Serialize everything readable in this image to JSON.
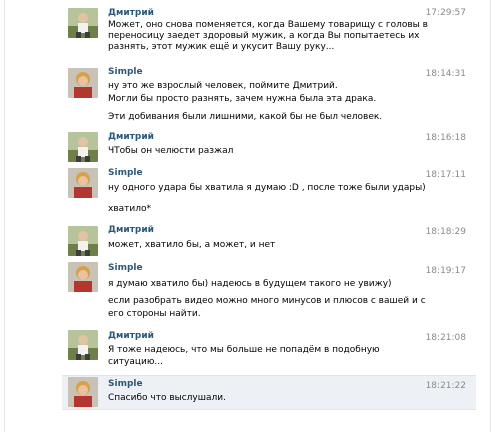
{
  "messages": [
    {
      "sender": "Дмитрий",
      "time": "17:29:57",
      "lines": [
        "Может, оно снова поменяется, когда Вашему товарищу с головы в",
        "переносицу заедет здоровый мужик, а когда Вы попытаетесь их",
        "разнять, этот мужик ещё и укусит Вашу руку..."
      ]
    },
    {
      "sender": "Simple",
      "time": "18:14:31",
      "lines": [
        "ну это же взрослый человек, поймите Дмитрий.",
        "Могли бы просто разнять, зачем нужна была эта драка.",
        "Эти добивания были лишними, какой бы не был человек."
      ]
    },
    {
      "sender": "Дмитрий",
      "time": "18:16:18",
      "lines": [
        "ЧТобы он челюсти разжал"
      ]
    },
    {
      "sender": "Simple",
      "time": "18:17:11",
      "lines": [
        "ну одного удара бы хватила я думаю :D , после тоже были удары)",
        "хватило*"
      ]
    },
    {
      "sender": "Дмитрий",
      "time": "18:18:29",
      "lines": [
        "может, хватило бы, а может, и нет"
      ]
    },
    {
      "sender": "Simple",
      "time": "18:19:17",
      "lines": [
        "я думаю хватило бы) надеюсь в будущем такого не увижу)",
        "если разобрать видео можно много минусов и плюсов с вашей и с",
        "его стороны найти."
      ]
    },
    {
      "sender": "Дмитрий",
      "time": "18:21:08",
      "lines": [
        "Я тоже надеюсь, что мы больше не попадём в подобную",
        "ситуацию..."
      ]
    },
    {
      "sender": "Simple",
      "time": "18:21:22",
      "lines": [
        "Спасибо что выслушали."
      ]
    }
  ],
  "colors": {
    "name": "#2b587a",
    "time": "#8a8a8a",
    "highlight_bg": "#edf1f5"
  }
}
